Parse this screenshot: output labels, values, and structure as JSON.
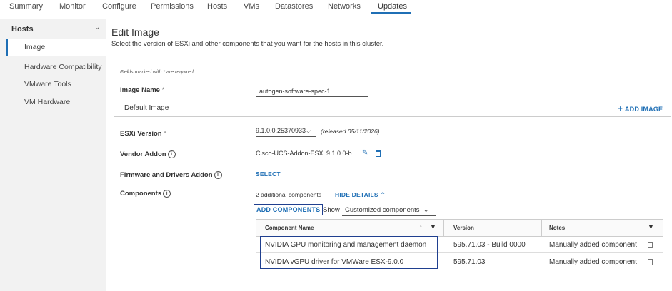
{
  "tabs": [
    {
      "label": "Summary"
    },
    {
      "label": "Monitor"
    },
    {
      "label": "Configure"
    },
    {
      "label": "Permissions"
    },
    {
      "label": "Hosts"
    },
    {
      "label": "VMs"
    },
    {
      "label": "Datastores"
    },
    {
      "label": "Networks"
    },
    {
      "label": "Updates"
    }
  ],
  "active_tab": "Updates",
  "sidebar": {
    "header": "Hosts",
    "items": [
      {
        "label": "Image",
        "selected": true
      },
      {
        "label": "Hardware Compatibility"
      },
      {
        "label": "VMware Tools"
      },
      {
        "label": "VM Hardware"
      }
    ]
  },
  "main": {
    "title": "Edit Image",
    "subtitle": "Select the version of ESXi and other components that you want for the hosts in this cluster.",
    "required_note": "Fields marked with",
    "required_star": "*",
    "required_suffix": "are required",
    "image_name_label": "Image Name",
    "image_name_value": "autogen-software-spec-1",
    "image_tab": "Default Image",
    "add_image": "ADD IMAGE",
    "esxi_label": "ESXi Version",
    "esxi_value": "9.1.0.0.25370933",
    "esxi_released": "(released 05/11/2026)",
    "vendor_label": "Vendor Addon",
    "vendor_value": "Cisco-UCS-Addon-ESXi 9.1.0.0-b",
    "firmware_label": "Firmware and Drivers Addon",
    "firmware_value": "SELECT",
    "components_label": "Components",
    "components_count": "2 additional components",
    "hide_details": "HIDE DETAILS",
    "add_components": "ADD COMPONENTS",
    "show_label": "Show",
    "show_value": "Customized components"
  },
  "grid": {
    "columns": [
      "Component Name",
      "Version",
      "Notes"
    ],
    "rows": [
      {
        "name": "NVIDIA GPU monitoring and management daemon",
        "version": "595.71.03 - Build 0000",
        "notes": "Manually added component"
      },
      {
        "name": "NVIDIA vGPU driver for VMWare ESX-9.0.0",
        "version": "595.71.03",
        "notes": "Manually added component"
      }
    ]
  },
  "colors": {
    "accent": "#1f6fb5",
    "sidebar_bg": "#f2f2f2",
    "highlight_border": "#1f3f8f"
  }
}
